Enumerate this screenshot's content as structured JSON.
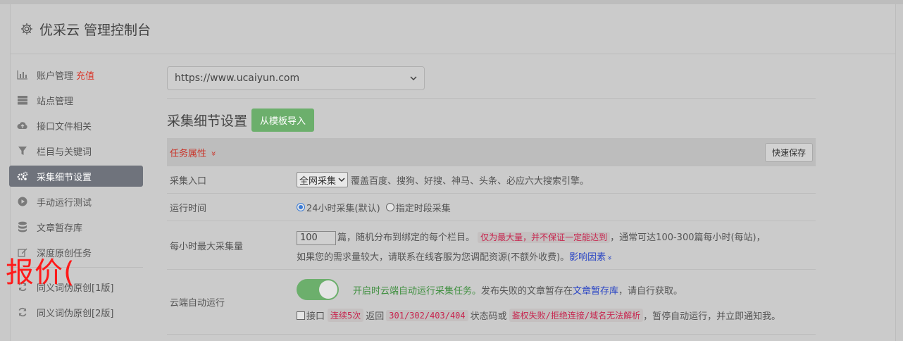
{
  "header": {
    "title": "优采云 管理控制台"
  },
  "sidebar": {
    "items": [
      {
        "label": "账户管理",
        "badge": "充值",
        "icon": "bar-chart-icon"
      },
      {
        "label": "站点管理",
        "icon": "server-icon"
      },
      {
        "label": "接口文件相关",
        "icon": "cloud-upload-icon"
      },
      {
        "label": "栏目与关键词",
        "icon": "filter-icon"
      },
      {
        "label": "采集细节设置",
        "icon": "gears-icon",
        "active": true
      },
      {
        "label": "手动运行测试",
        "icon": "play-icon"
      },
      {
        "label": "文章暂存库",
        "icon": "database-icon"
      },
      {
        "label": "深度原创任务",
        "icon": "edit-icon"
      },
      {
        "label": "同义词伪原创[1版]",
        "icon": "refresh-icon"
      },
      {
        "label": "同义词伪原创[2版]",
        "icon": "refresh-icon"
      }
    ]
  },
  "watermark": "报价(",
  "main": {
    "site_select": "https://www.ucaiyun.com",
    "section_title": "采集细节设置",
    "import_button": "从模板导入",
    "task_attr": "任务属性",
    "task_attr_chevron": "»",
    "quick_save": "快速保存",
    "rows": {
      "entry": {
        "label": "采集入口",
        "select": "全网采集",
        "desc": "覆盖百度、搜狗、好搜、神马、头条、必应六大搜索引擎。"
      },
      "runtime": {
        "label": "运行时间",
        "opt1": "24小时采集(默认)",
        "opt2": "指定时段采集"
      },
      "max": {
        "label": "每小时最大采集量",
        "value": "100",
        "text1": "篇，随机分布到绑定的每个栏目。",
        "code1": "仅为最大量，并不保证一定能达到",
        "text2": "，通常可达100-300篇每小时(每站)，",
        "text3": "如果您的需求量较大，请联系在线客服为您调配资源(不额外收费)。",
        "link": "影响因素",
        "link_chevron": "»"
      },
      "cloud": {
        "label": "云端自动运行",
        "green": "开启时云端自动运行采集任务。",
        "text1": "发布失败的文章暂存在",
        "link": "文章暂存库",
        "text2": "，请自行获取。",
        "chk_label": "接口",
        "code1": "连续5次",
        "text3": "返回",
        "code2": "301/302/403/404",
        "text4": "状态码或",
        "code3": "鉴权失败/拒绝连接/域名无法解析",
        "text5": "，暂停自动运行，并立即通知我。"
      }
    }
  }
}
